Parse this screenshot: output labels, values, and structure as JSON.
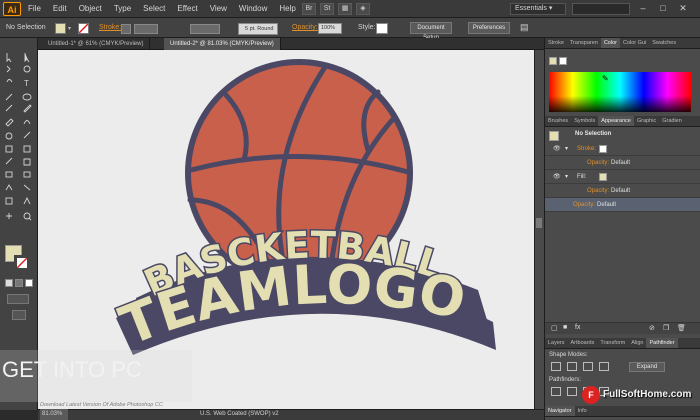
{
  "app": {
    "logo_text": "Ai"
  },
  "menu": [
    "File",
    "Edit",
    "Object",
    "Type",
    "Select",
    "Effect",
    "View",
    "Window",
    "Help"
  ],
  "workspace": {
    "label": "Essentials ▾"
  },
  "control_bar": {
    "selection_label": "No Selection",
    "stroke_label": "Stroke:",
    "brush_label": "5 pt. Round",
    "opacity_label": "Opacity:",
    "opacity_value": "100%",
    "style_label": "Style:",
    "doc_setup_button": "Document Setup",
    "preferences_button": "Preferences"
  },
  "tabs": [
    {
      "label": "Untitled-1* @ 61% (CMYK/Preview)",
      "active": false
    },
    {
      "label": "Untitled-2* @ 81.03% (CMYK/Preview)",
      "active": true
    }
  ],
  "artwork": {
    "line1": "BASCKETBALL",
    "line2": "TEAMLOGO",
    "ball_color": "#c8604c",
    "outline_color": "#4a4864",
    "text_fill": "#e3dfb2"
  },
  "status": {
    "zoom": "81.03%",
    "profile": "U.S. Web Coated (SWOP) v2",
    "watermark": "Download Latest Version Of Adobe Photoshop CC"
  },
  "panels": {
    "color_tabs": [
      "Stroke",
      "Transparen",
      "Color",
      "Color Gui",
      "Swatches"
    ],
    "appearance_tabs": [
      "Brushes",
      "Symbols",
      "Appearance",
      "Graphic",
      "Gradien"
    ],
    "appearance": {
      "header": "No Selection",
      "stroke_label": "Stroke:",
      "opacity1": "Opacity:",
      "opacity1_value": "Default",
      "fill_label": "Fill:",
      "opacity2": "Opacity:",
      "opacity2_value": "Default",
      "opacity3": "Opacity:",
      "opacity3_value": "Default"
    },
    "bottom_tabs": [
      "Layers",
      "Artboards",
      "Transform",
      "Align",
      "Pathfinder"
    ],
    "shape_modes_label": "Shape Modes:",
    "expand_button": "Expand",
    "pathfinders_label": "Pathfinders:",
    "navigator_tabs": [
      "Navigator",
      "Info"
    ]
  },
  "watermarks": {
    "left": "GET INTO PC",
    "right": "FullSoftHome.com"
  }
}
